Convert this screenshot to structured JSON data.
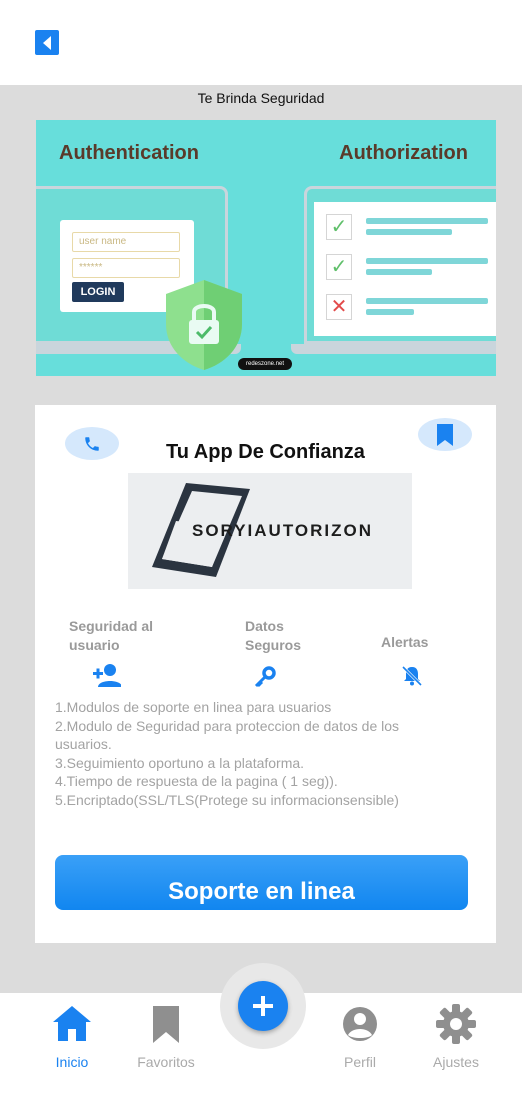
{
  "header": {
    "back_icon": "chevron-left-icon"
  },
  "banner": {
    "caption": "Te Brinda Seguridad",
    "image": {
      "left_title": "Authentication",
      "right_title": "Authorization",
      "username_placeholder": "user name",
      "password_mask": "******",
      "login_label": "LOGIN",
      "watermark": "redeszone.net"
    }
  },
  "card": {
    "phone_icon": "phone-icon",
    "bookmark_icon": "bookmark-icon",
    "title": "Tu App De Confianza",
    "logo_text": "SORYIAUTORIZON",
    "features": [
      {
        "label": "Seguridad al usuario",
        "icon": "add-user-icon"
      },
      {
        "label": "Datos Seguros",
        "icon": "key-icon"
      },
      {
        "label": "Alertas",
        "icon": "bell-off-icon"
      }
    ],
    "list": [
      "1.Modulos de soporte en linea para usuarios",
      "2.Modulo de Seguridad para proteccion de datos de los usuarios.",
      "3.Seguimiento oportuno a la plataforma.",
      "4.Tiempo de respuesta de la pagina ( 1 seg)).",
      "5.Encriptado(SSL/TLS(Protege su informacionsensible)"
    ],
    "support_button": "Soporte en linea"
  },
  "bottom_nav": {
    "fab_icon": "plus-icon",
    "items": [
      {
        "label": "Inicio",
        "icon": "home-icon",
        "active": true
      },
      {
        "label": "Favoritos",
        "icon": "bookmark-icon",
        "active": false
      },
      {
        "label": "Perfil",
        "icon": "user-circle-icon",
        "active": false
      },
      {
        "label": "Ajustes",
        "icon": "gear-icon",
        "active": false
      }
    ]
  },
  "colors": {
    "accent": "#1a82f0",
    "background": "#dcdcdc",
    "hero": "#67dedb"
  }
}
